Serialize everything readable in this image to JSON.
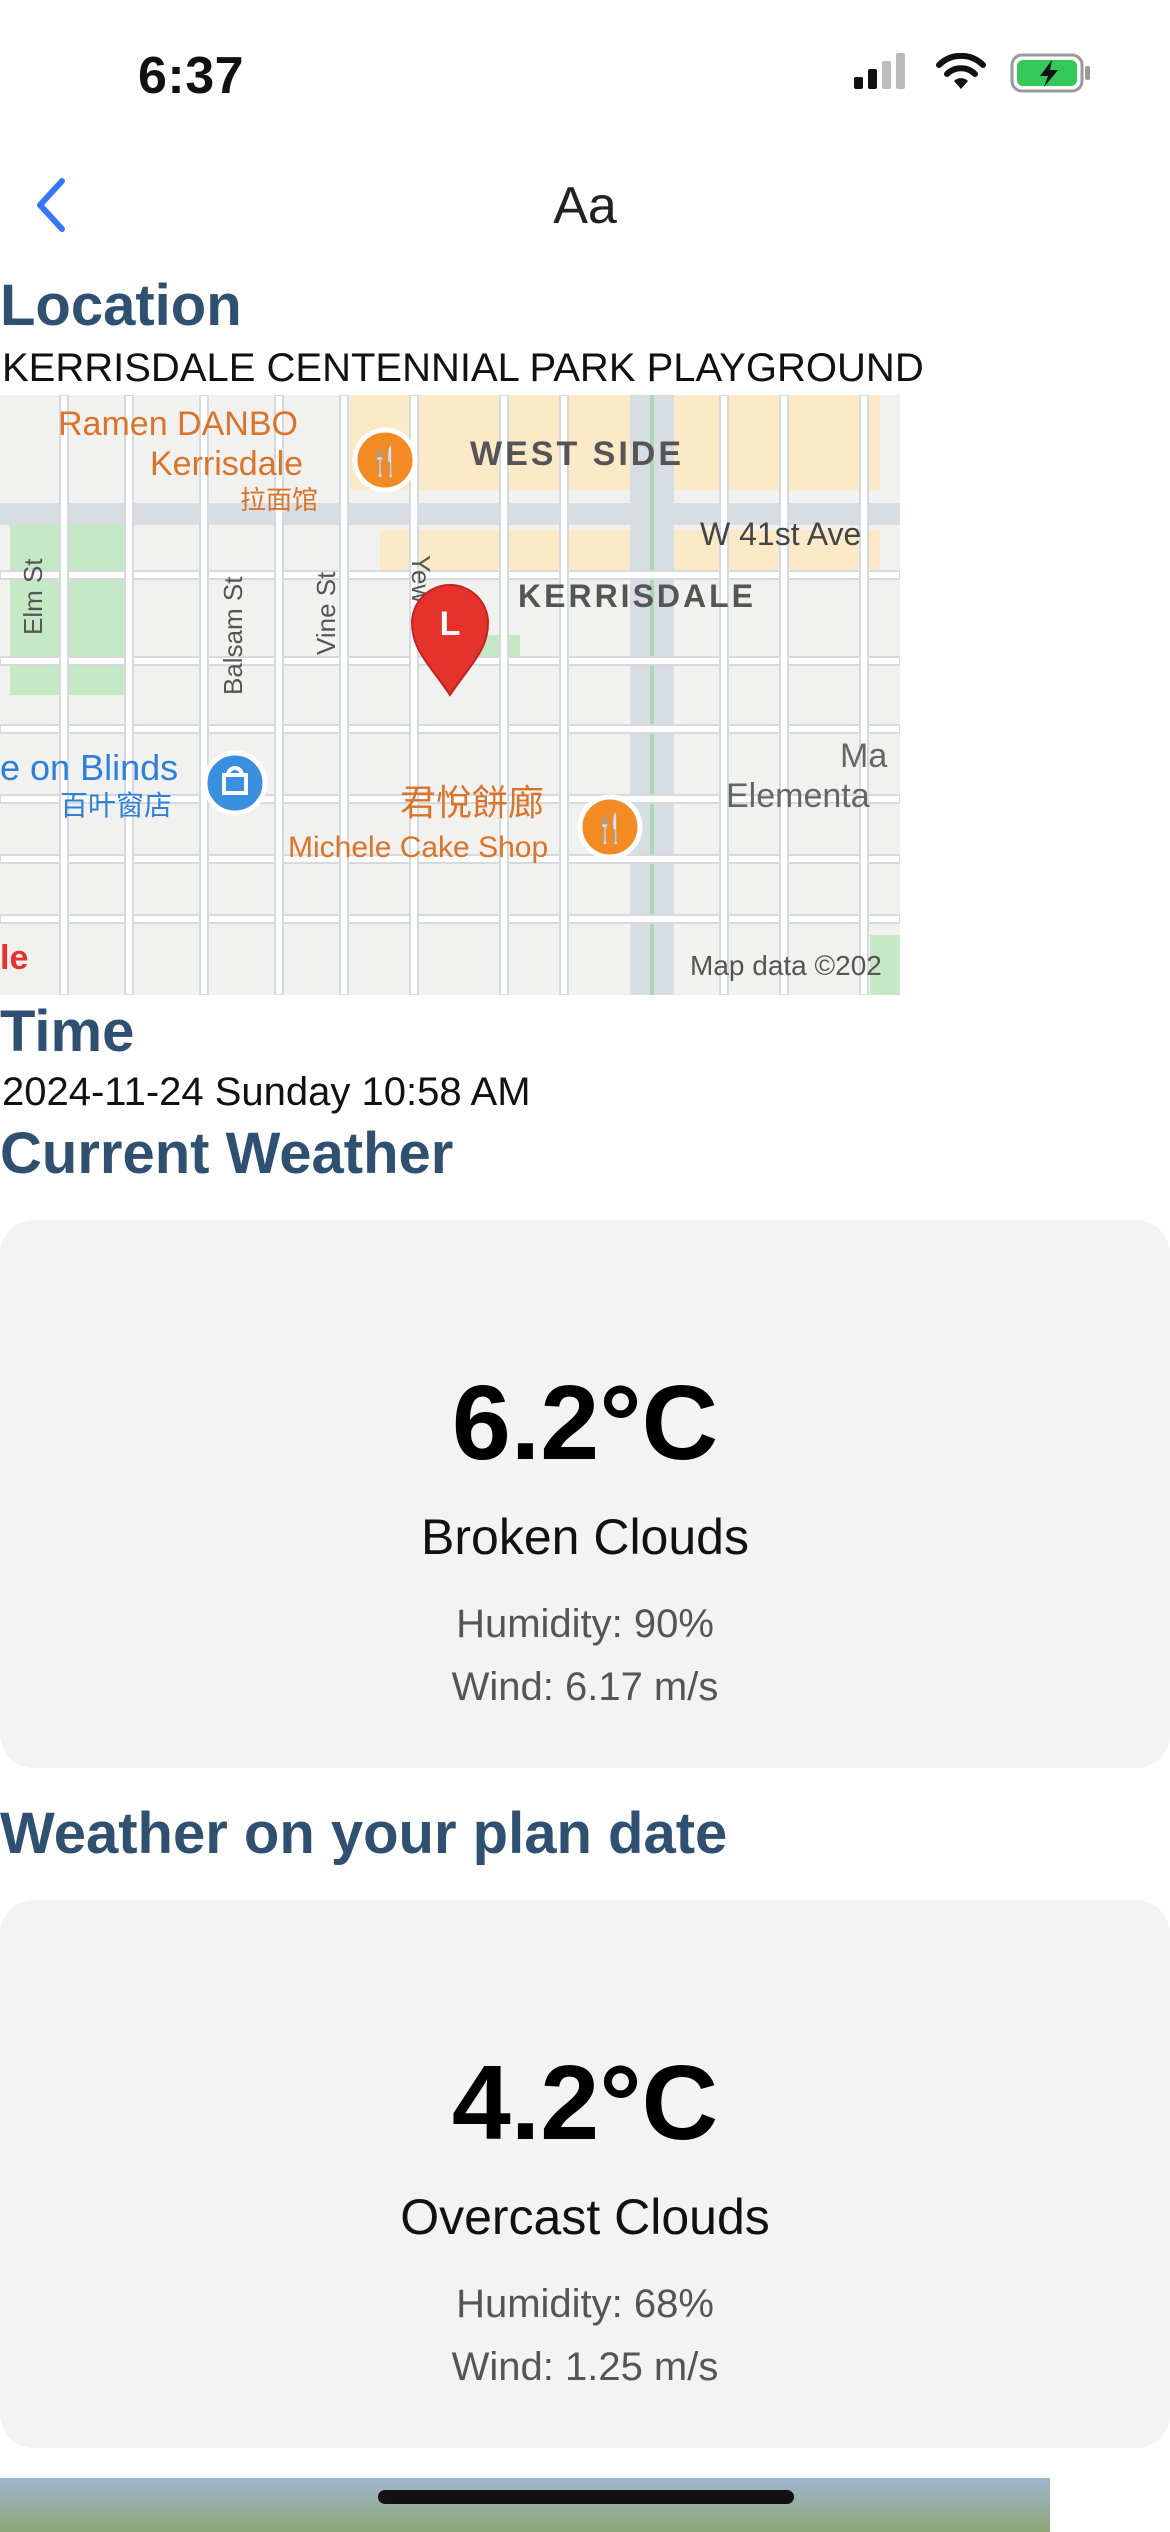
{
  "status_bar": {
    "time": "6:37"
  },
  "nav": {
    "title": "Aa",
    "back_icon": "chevron-left-icon"
  },
  "location": {
    "heading": "Location",
    "name": "KERRISDALE CENTENNIAL PARK PLAYGROUND"
  },
  "map": {
    "pin_letter": "L",
    "attribution": "Map data ©202",
    "labels": {
      "ramen_en_1": "Ramen DANBO",
      "ramen_en_2": "Kerrisdale",
      "ramen_zh": "拉面馆",
      "west_side": "WEST SIDE",
      "w41": "W 41st Ave",
      "kerrisdale": "KERRISDALE",
      "elm": "Elm St",
      "balsam": "Balsam St",
      "vine": "Vine St",
      "yew": "Yew",
      "blinds_en": "e on Blinds",
      "blinds_zh": "百叶窗店",
      "cake_zh": "君悅餅廊",
      "cake_en": "Michele Cake Shop",
      "ma": "Ma",
      "elementa": "Elementa",
      "google_fragment": "le"
    },
    "colors": {
      "pin": "#e5322d",
      "food_marker": "#f28b24",
      "shop_marker": "#3a8fde",
      "park": "#c5e8c5"
    }
  },
  "time": {
    "heading": "Time",
    "value": "2024-11-24 Sunday 10:58 AM"
  },
  "current_weather": {
    "heading": "Current Weather",
    "temp": "6.2°C",
    "condition": "Broken Clouds",
    "humidity": "Humidity: 90%",
    "wind": "Wind: 6.17 m/s"
  },
  "plan_weather": {
    "heading": "Weather on your plan date",
    "temp": "4.2°C",
    "condition": "Overcast Clouds",
    "humidity": "Humidity: 68%",
    "wind": "Wind: 1.25 m/s"
  },
  "colors": {
    "heading": "#2f5070",
    "accent": "#3478f6",
    "card_bg": "#f3f3f3"
  }
}
